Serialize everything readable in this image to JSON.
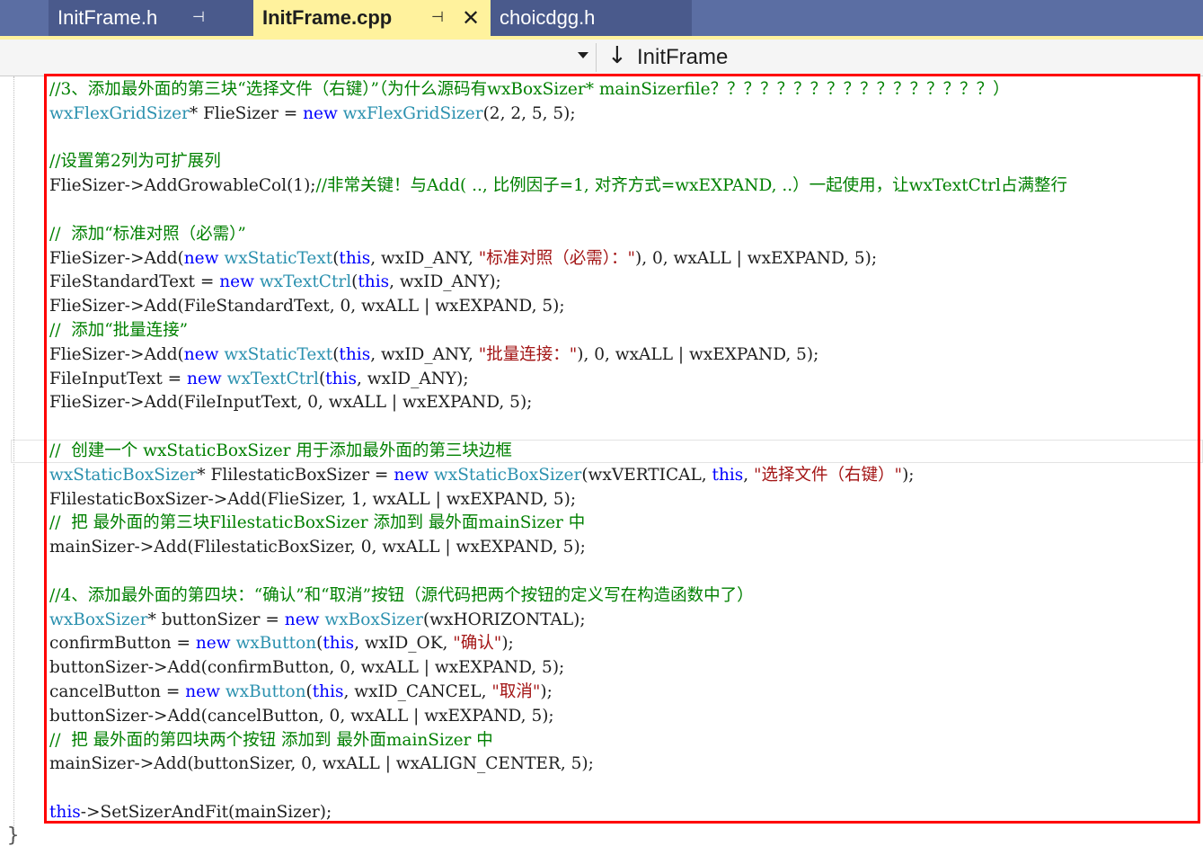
{
  "tabs": [
    {
      "title": "InitFrame.h",
      "pin": "⊣",
      "active": false
    },
    {
      "title": "InitFrame.cpp",
      "pin": "⊣",
      "close": "✕",
      "active": true
    },
    {
      "title": "choicdgg.h",
      "active": false
    }
  ],
  "navbar": {
    "member_icon": "↓",
    "member": "InitFrame"
  },
  "code_lines": [
    [
      {
        "c": "c",
        "t": "//3、添加最外面的第三块“选择文件（右键）”（为什么源码有wxBoxSizer* mainSizerfile？？？？？？？？？？？？？？？？？）"
      }
    ],
    [
      {
        "c": "t",
        "t": "wxFlexGridSizer"
      },
      {
        "c": "p",
        "t": "* "
      },
      {
        "c": "p",
        "t": "FlieSizer = "
      },
      {
        "c": "k",
        "t": "new"
      },
      {
        "c": "p",
        "t": " "
      },
      {
        "c": "t",
        "t": "wxFlexGridSizer"
      },
      {
        "c": "p",
        "t": "(2, 2, 5, 5);"
      }
    ],
    [
      {
        "c": "p",
        "t": ""
      }
    ],
    [
      {
        "c": "c",
        "t": "//设置第2列为可扩展列"
      }
    ],
    [
      {
        "c": "p",
        "t": "FlieSizer->AddGrowableCol(1);"
      },
      {
        "c": "c",
        "t": "//非常关键！与Add( .., 比例因子=1, 对齐方式=wxEXPAND, ..）一起使用，让wxTextCtrl占满整行"
      }
    ],
    [
      {
        "c": "p",
        "t": ""
      }
    ],
    [
      {
        "c": "c",
        "t": "//  添加“标准对照（必需）”"
      }
    ],
    [
      {
        "c": "p",
        "t": "FlieSizer->Add("
      },
      {
        "c": "k",
        "t": "new"
      },
      {
        "c": "p",
        "t": " "
      },
      {
        "c": "t",
        "t": "wxStaticText"
      },
      {
        "c": "p",
        "t": "("
      },
      {
        "c": "k",
        "t": "this"
      },
      {
        "c": "p",
        "t": ", wxID_ANY, "
      },
      {
        "c": "s",
        "t": "\"标准对照（必需）：\""
      },
      {
        "c": "p",
        "t": "), 0, wxALL | wxEXPAND, 5);"
      }
    ],
    [
      {
        "c": "p",
        "t": "FileStandardText = "
      },
      {
        "c": "k",
        "t": "new"
      },
      {
        "c": "p",
        "t": " "
      },
      {
        "c": "t",
        "t": "wxTextCtrl"
      },
      {
        "c": "p",
        "t": "("
      },
      {
        "c": "k",
        "t": "this"
      },
      {
        "c": "p",
        "t": ", wxID_ANY);"
      }
    ],
    [
      {
        "c": "p",
        "t": "FlieSizer->Add(FileStandardText, 0, wxALL | wxEXPAND, 5);"
      }
    ],
    [
      {
        "c": "c",
        "t": "//  添加“批量连接”"
      }
    ],
    [
      {
        "c": "p",
        "t": "FlieSizer->Add("
      },
      {
        "c": "k",
        "t": "new"
      },
      {
        "c": "p",
        "t": " "
      },
      {
        "c": "t",
        "t": "wxStaticText"
      },
      {
        "c": "p",
        "t": "("
      },
      {
        "c": "k",
        "t": "this"
      },
      {
        "c": "p",
        "t": ", wxID_ANY, "
      },
      {
        "c": "s",
        "t": "\"批量连接：\""
      },
      {
        "c": "p",
        "t": "), 0, wxALL | wxEXPAND, 5);"
      }
    ],
    [
      {
        "c": "p",
        "t": "FileInputText = "
      },
      {
        "c": "k",
        "t": "new"
      },
      {
        "c": "p",
        "t": " "
      },
      {
        "c": "t",
        "t": "wxTextCtrl"
      },
      {
        "c": "p",
        "t": "("
      },
      {
        "c": "k",
        "t": "this"
      },
      {
        "c": "p",
        "t": ", wxID_ANY);"
      }
    ],
    [
      {
        "c": "p",
        "t": "FlieSizer->Add(FileInputText, 0, wxALL | wxEXPAND, 5);"
      }
    ],
    [
      {
        "c": "p",
        "t": ""
      }
    ],
    [
      {
        "c": "c",
        "t": "//  创建一个 wxStaticBoxSizer 用于添加最外面的第三块边框"
      }
    ],
    [
      {
        "c": "t",
        "t": "wxStaticBoxSizer"
      },
      {
        "c": "p",
        "t": "* FlilestaticBoxSizer = "
      },
      {
        "c": "k",
        "t": "new"
      },
      {
        "c": "p",
        "t": " "
      },
      {
        "c": "t",
        "t": "wxStaticBoxSizer"
      },
      {
        "c": "p",
        "t": "(wxVERTICAL, "
      },
      {
        "c": "k",
        "t": "this"
      },
      {
        "c": "p",
        "t": ", "
      },
      {
        "c": "s",
        "t": "\"选择文件（右键）\""
      },
      {
        "c": "p",
        "t": ");"
      }
    ],
    [
      {
        "c": "p",
        "t": "FlilestaticBoxSizer->Add(FlieSizer, 1, wxALL | wxEXPAND, 5);"
      }
    ],
    [
      {
        "c": "c",
        "t": "//  把 最外面的第三块FlilestaticBoxSizer 添加到 最外面mainSizer 中"
      }
    ],
    [
      {
        "c": "p",
        "t": "mainSizer->Add(FlilestaticBoxSizer, 0, wxALL | wxEXPAND, 5);"
      }
    ],
    [
      {
        "c": "p",
        "t": ""
      }
    ],
    [
      {
        "c": "c",
        "t": "//4、添加最外面的第四块：“确认”和“取消”按钮（源代码把两个按钮的定义写在构造函数中了）"
      }
    ],
    [
      {
        "c": "t",
        "t": "wxBoxSizer"
      },
      {
        "c": "p",
        "t": "* buttonSizer = "
      },
      {
        "c": "k",
        "t": "new"
      },
      {
        "c": "p",
        "t": " "
      },
      {
        "c": "t",
        "t": "wxBoxSizer"
      },
      {
        "c": "p",
        "t": "(wxHORIZONTAL);"
      }
    ],
    [
      {
        "c": "p",
        "t": "confirmButton = "
      },
      {
        "c": "k",
        "t": "new"
      },
      {
        "c": "p",
        "t": " "
      },
      {
        "c": "t",
        "t": "wxButton"
      },
      {
        "c": "p",
        "t": "("
      },
      {
        "c": "k",
        "t": "this"
      },
      {
        "c": "p",
        "t": ", wxID_OK, "
      },
      {
        "c": "s",
        "t": "\"确认\""
      },
      {
        "c": "p",
        "t": ");"
      }
    ],
    [
      {
        "c": "p",
        "t": "buttonSizer->Add(confirmButton, 0, wxALL | wxEXPAND, 5);"
      }
    ],
    [
      {
        "c": "p",
        "t": "cancelButton = "
      },
      {
        "c": "k",
        "t": "new"
      },
      {
        "c": "p",
        "t": " "
      },
      {
        "c": "t",
        "t": "wxButton"
      },
      {
        "c": "p",
        "t": "("
      },
      {
        "c": "k",
        "t": "this"
      },
      {
        "c": "p",
        "t": ", wxID_CANCEL, "
      },
      {
        "c": "s",
        "t": "\"取消\""
      },
      {
        "c": "p",
        "t": ");"
      }
    ],
    [
      {
        "c": "p",
        "t": "buttonSizer->Add(cancelButton, 0, wxALL | wxEXPAND, 5);"
      }
    ],
    [
      {
        "c": "c",
        "t": "//  把 最外面的第四块两个按钮 添加到 最外面mainSizer 中"
      }
    ],
    [
      {
        "c": "p",
        "t": "mainSizer->Add(buttonSizer, 0, wxALL | wxALIGN_CENTER, 5);"
      }
    ],
    [
      {
        "c": "p",
        "t": ""
      }
    ],
    [
      {
        "c": "k",
        "t": "this"
      },
      {
        "c": "p",
        "t": "->SetSizerAndFit(mainSizer);"
      }
    ]
  ],
  "closing_brace": "}",
  "colors": {
    "tab_active": "#fff29d",
    "tab_bg": "#5b6ea3",
    "comment": "#008000",
    "keyword": "#0000ff",
    "type": "#2b91af",
    "string": "#a31515",
    "highlight_box": "#ff0000"
  }
}
